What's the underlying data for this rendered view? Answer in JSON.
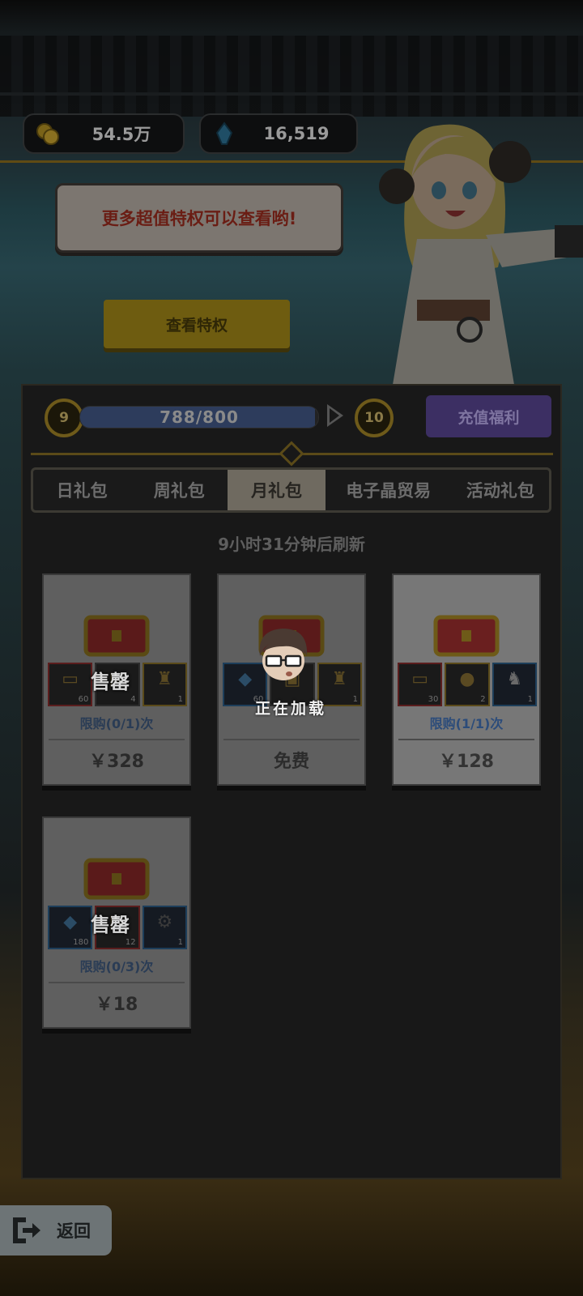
{
  "currency": {
    "coins": "54.5万",
    "crystals": "16,519"
  },
  "promo": {
    "speech": "更多超值特权可以查看哟!",
    "button_label": "查看特权"
  },
  "level": {
    "current": "9",
    "next": "10",
    "progress_text": "788/800",
    "progress_fraction": 0.985,
    "recharge_label": "充值福利"
  },
  "tabs": [
    {
      "label": "日礼包"
    },
    {
      "label": "周礼包"
    },
    {
      "label": "月礼包",
      "active": true
    },
    {
      "label": "电子晶贸易"
    },
    {
      "label": "活动礼包"
    }
  ],
  "refresh_text": "9小时31分钟后刷新",
  "packs": [
    {
      "items": [
        {
          "icon": "ticket-icon",
          "count": "60"
        },
        {
          "icon": "chest-icon",
          "count": "4"
        },
        {
          "icon": "trophy-icon",
          "count": "1"
        }
      ],
      "soldout": "售罄",
      "limit": "限购(0/1)次",
      "price": "￥328"
    },
    {
      "items": [
        {
          "icon": "crystal-icon",
          "count": "60"
        },
        {
          "icon": "chest-icon",
          "count": ""
        },
        {
          "icon": "trophy-icon",
          "count": "1"
        }
      ],
      "soldout": "",
      "limit": "",
      "price": "免费"
    },
    {
      "items": [
        {
          "icon": "ticket-icon",
          "count": "30"
        },
        {
          "icon": "medal-icon",
          "count": "2"
        },
        {
          "icon": "figure-icon",
          "count": "1"
        }
      ],
      "soldout": "",
      "limit": "限购(1/1)次",
      "price": "￥128"
    },
    {
      "items": [
        {
          "icon": "crystal-icon",
          "count": "180"
        },
        {
          "icon": "chest-icon",
          "count": "12"
        },
        {
          "icon": "gear-icon",
          "count": "1"
        }
      ],
      "soldout": "售罄",
      "limit": "限购(0/3)次",
      "price": "￥18"
    }
  ],
  "loading_text": "正在加载",
  "back_label": "返回"
}
